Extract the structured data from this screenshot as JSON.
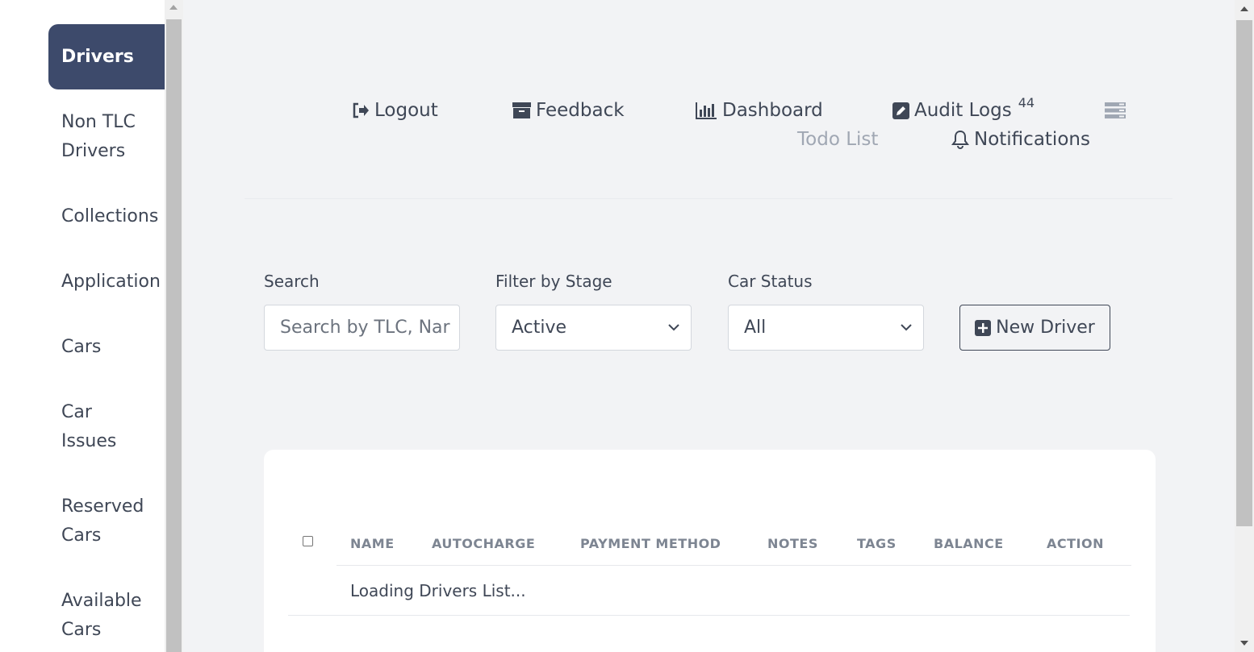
{
  "sidebar": {
    "items": [
      {
        "label": "Drivers",
        "active": true
      },
      {
        "label_lines": [
          "Non TLC",
          "Drivers"
        ]
      },
      {
        "label": "Collections"
      },
      {
        "label": "Application"
      },
      {
        "label": "Cars"
      },
      {
        "label_lines": [
          "Car",
          "Issues"
        ]
      },
      {
        "label_lines": [
          "Reserved",
          "Cars"
        ]
      },
      {
        "label_lines": [
          "Available",
          "Cars"
        ]
      }
    ]
  },
  "topnav": {
    "logout": "Logout",
    "feedback": "Feedback",
    "dashboard": "Dashboard",
    "audit_logs": "Audit Logs",
    "audit_logs_count": "44",
    "todo_list": "Todo List",
    "notifications": "Notifications"
  },
  "filters": {
    "search_label": "Search",
    "search_placeholder": "Search by TLC, Nar",
    "stage_label": "Filter by Stage",
    "stage_value": "Active",
    "car_status_label": "Car Status",
    "car_status_value": "All",
    "new_driver_label": "New Driver"
  },
  "table": {
    "columns": [
      "NAME",
      "AUTOCHARGE",
      "PAYMENT METHOD",
      "NOTES",
      "TAGS",
      "BALANCE",
      "ACTION"
    ],
    "loading_text": "Loading Drivers List..."
  },
  "colors": {
    "accent": "#3d4a6b",
    "background": "#f2f3f5",
    "text": "#3f4756",
    "muted": "#a0a7b3"
  }
}
